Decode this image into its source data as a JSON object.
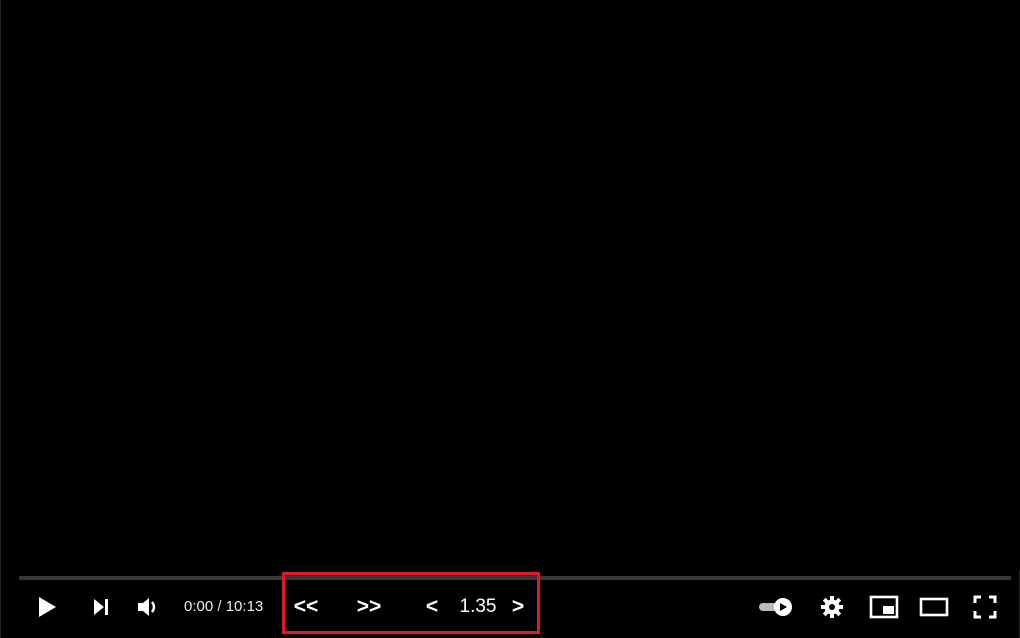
{
  "player": {
    "progress_fraction": 0.0,
    "accent_color": "#ff0000",
    "time": {
      "current": "0:00",
      "separator": " / ",
      "duration": "10:13"
    },
    "speed_extension": {
      "rewind_label": "<<",
      "forward_label": ">>",
      "slower_label": "<",
      "speed_value": "1.35",
      "faster_label": ">",
      "highlight_color": "#e2182a"
    },
    "icons": {
      "play": "play-icon",
      "next": "skip-next-icon",
      "volume": "volume-icon",
      "autoplay": "autoplay-toggle-icon",
      "settings": "gear-icon",
      "miniplayer": "miniplayer-icon",
      "theater": "theater-mode-icon",
      "fullscreen": "fullscreen-icon"
    }
  }
}
